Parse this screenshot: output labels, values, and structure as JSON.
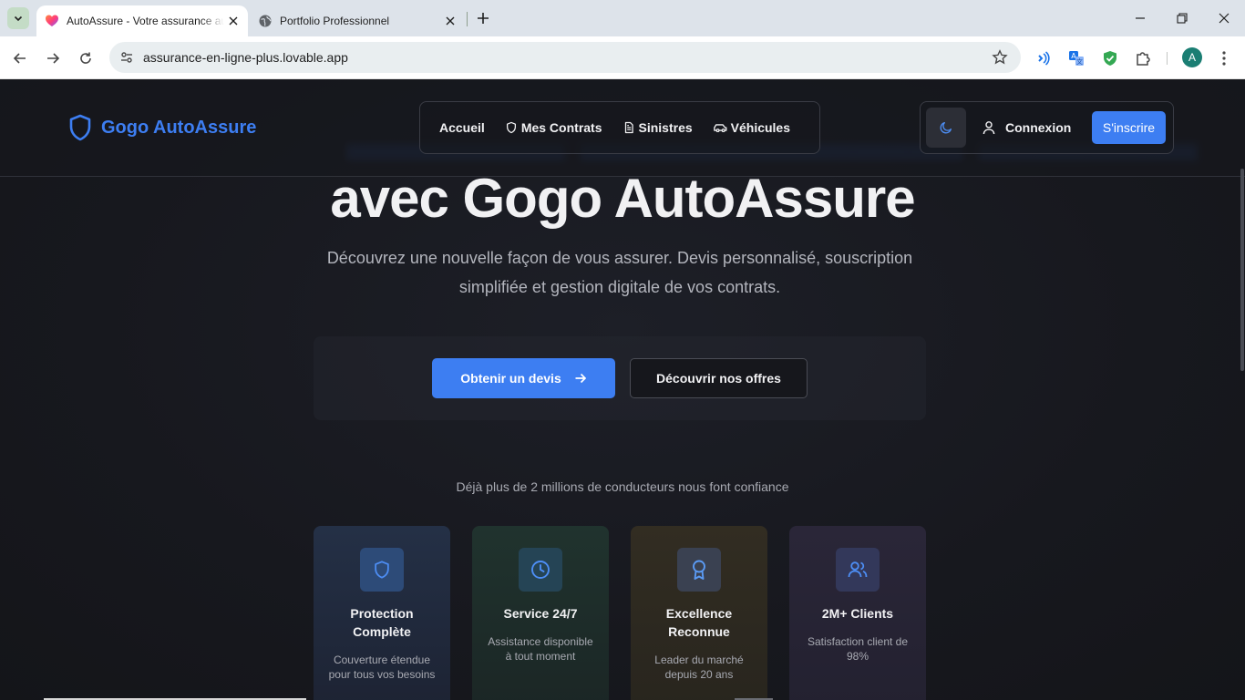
{
  "browser": {
    "tabs": [
      {
        "title": "AutoAssure - Votre assurance auto",
        "active": true,
        "favicon": "lovable-heart-icon"
      },
      {
        "title": "Portfolio Professionnel",
        "active": false,
        "favicon": "globe-icon"
      }
    ],
    "url": "assurance-en-ligne-plus.lovable.app",
    "profile_initial": "A"
  },
  "site": {
    "brand": "Gogo AutoAssure",
    "nav": [
      {
        "label": "Accueil",
        "icon": ""
      },
      {
        "label": "Mes Contrats",
        "icon": "shield-icon"
      },
      {
        "label": "Sinistres",
        "icon": "file-text-icon"
      },
      {
        "label": "Véhicules",
        "icon": "car-icon"
      }
    ],
    "login_label": "Connexion",
    "signup_label": "S'inscrire"
  },
  "hero": {
    "title_line": "avec Gogo AutoAssure",
    "description": "Découvrez une nouvelle façon de vous assurer. Devis personnalisé, souscription simplifiée et gestion digitale de vos contrats.",
    "cta_primary": "Obtenir un devis",
    "cta_secondary": "Découvrir nos offres"
  },
  "trust_text": "Déjà plus de 2 millions de conducteurs nous font confiance",
  "features": [
    {
      "title": "Protection Complète",
      "description": "Couverture étendue pour tous vos besoins",
      "icon": "shield-icon"
    },
    {
      "title": "Service 24/7",
      "description": "Assistance disponible à tout moment",
      "icon": "clock-icon"
    },
    {
      "title": "Excellence Reconnue",
      "description": "Leader du marché depuis 20 ans",
      "icon": "award-icon"
    },
    {
      "title": "2M+ Clients",
      "description": "Satisfaction client de 98%",
      "icon": "users-icon"
    }
  ],
  "colors": {
    "accent": "#3d7ef2",
    "background": "#16171d"
  }
}
